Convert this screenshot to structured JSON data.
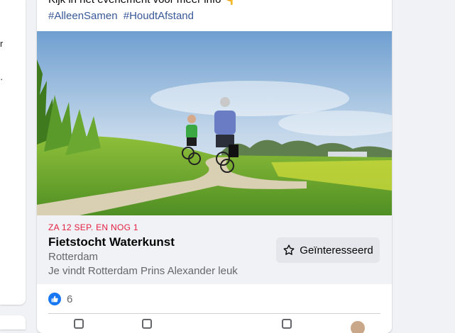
{
  "post": {
    "text_truncated": "Kijk in het evenement voor meer info 👇",
    "hashtags": [
      "#AlleenSamen",
      "#HoudtAfstand"
    ]
  },
  "event": {
    "date": "ZA 12 SEP. EN NOG 1",
    "title": "Fietstocht Waterkunst",
    "location": "Rotterdam",
    "friends_text": "Je vindt Rotterdam Prins Alexander leuk",
    "interested_label": "Geïnteresseerd"
  },
  "reactions": {
    "count": "6",
    "icon": "like-icon"
  },
  "colors": {
    "date_red": "#e41e3f",
    "hashtag_blue": "#385898",
    "like_blue": "#1877f2",
    "button_grey": "#e4e6eb"
  },
  "left_column": {
    "glyphs": [
      "r",
      "·"
    ]
  }
}
